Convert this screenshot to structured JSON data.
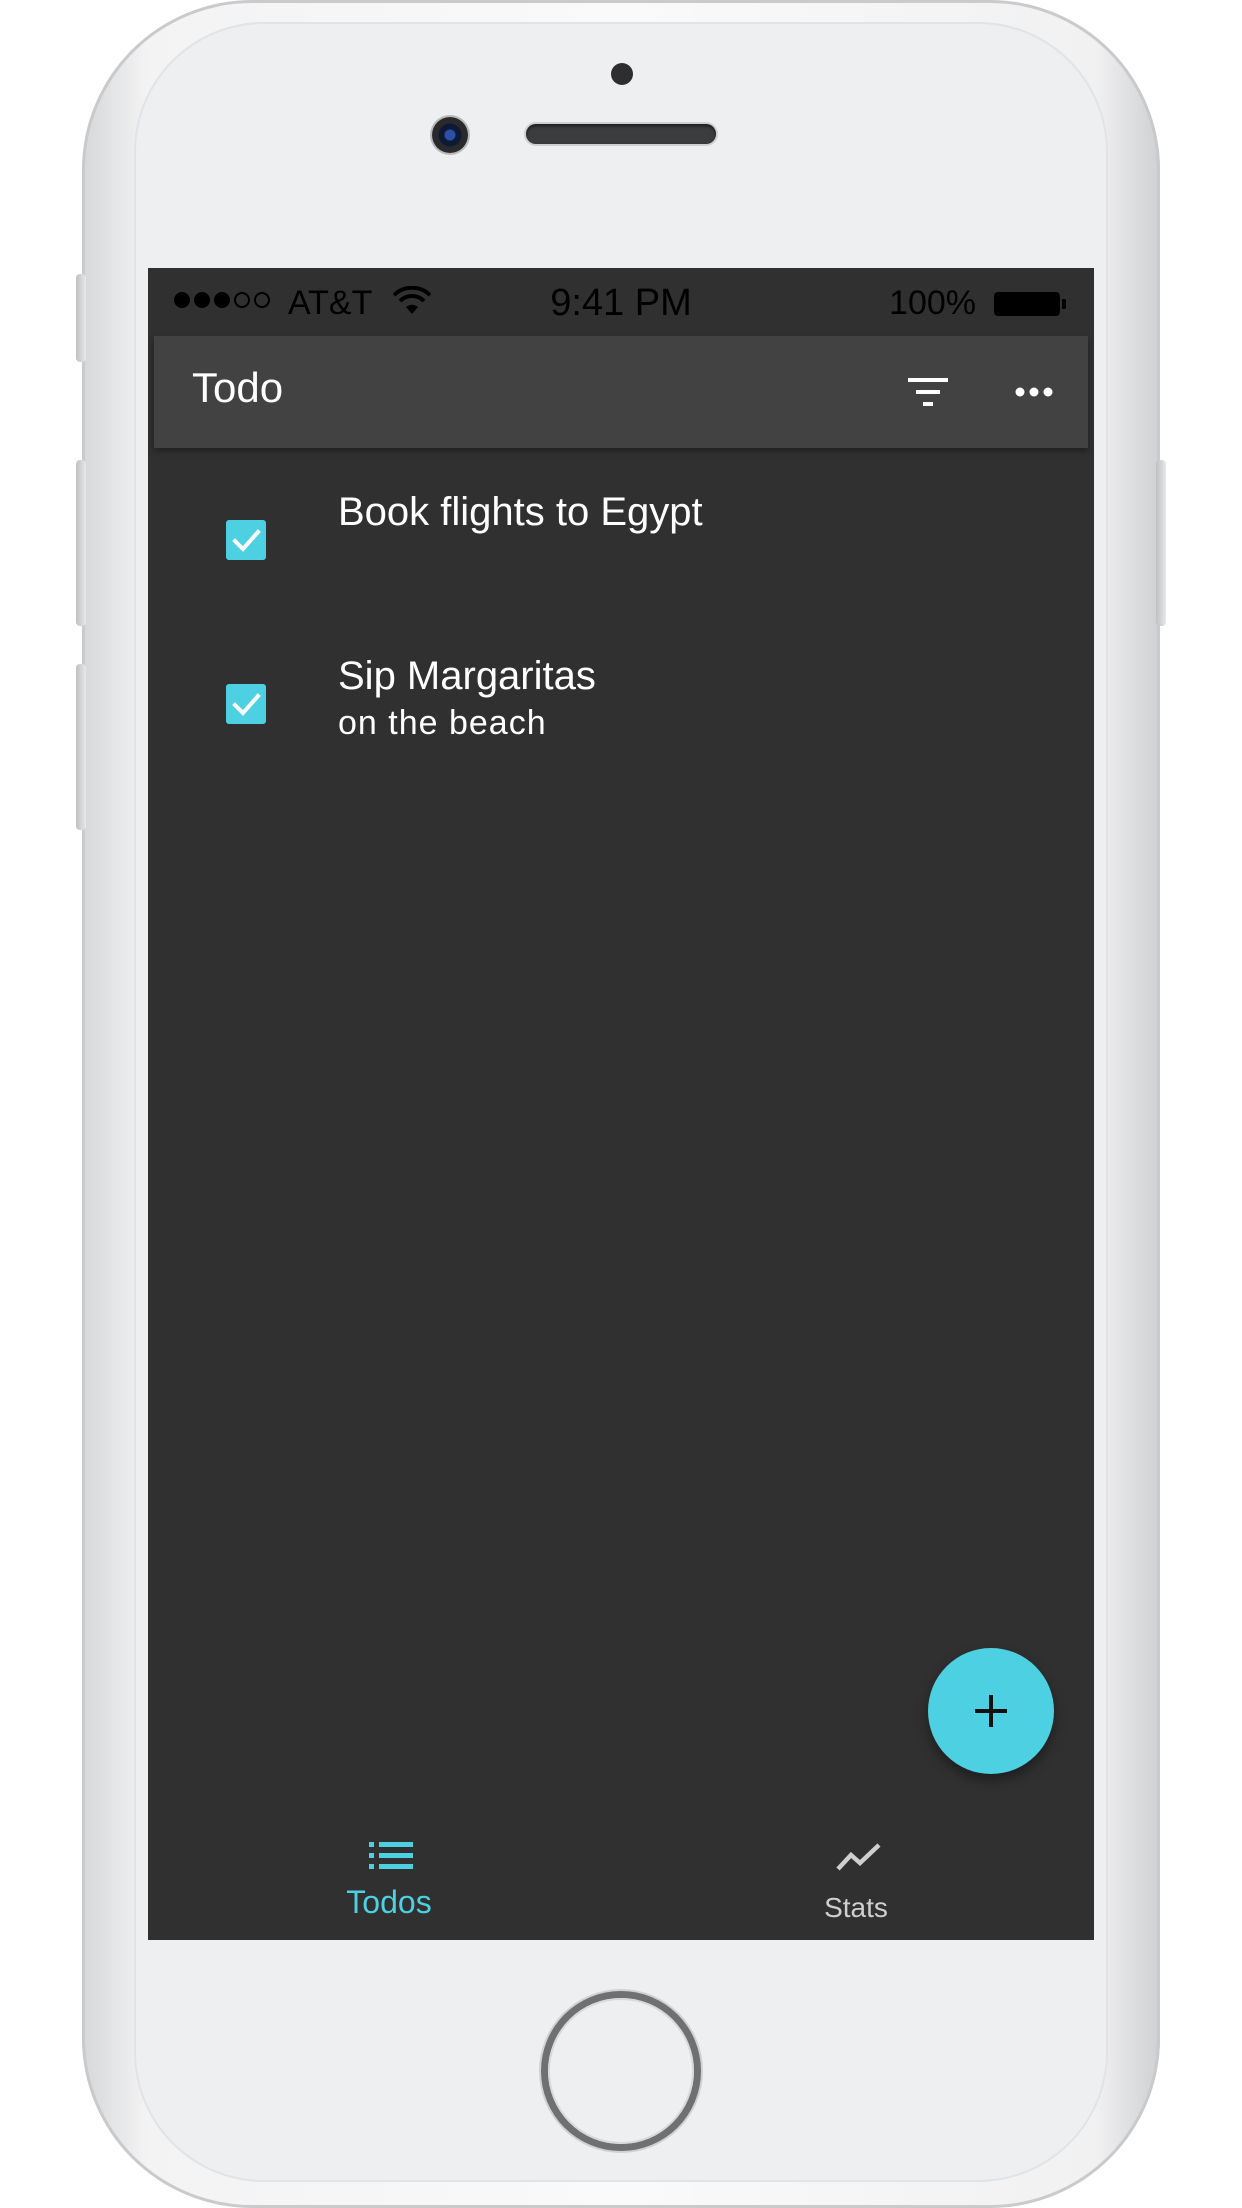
{
  "status_bar": {
    "carrier": "AT&T",
    "time": "9:41 PM",
    "battery": "100%"
  },
  "app_bar": {
    "title": "Todo",
    "actions": [
      "filter-icon",
      "more-icon"
    ]
  },
  "todos": [
    {
      "title": "Book flights to Egypt",
      "note": "",
      "completed": true
    },
    {
      "title": "Sip Margaritas",
      "note": "on the beach",
      "completed": true
    }
  ],
  "fab": {
    "icon": "plus-icon"
  },
  "bottom_nav": {
    "items": [
      {
        "label": "Todos",
        "icon": "list-icon",
        "active": true
      },
      {
        "label": "Stats",
        "icon": "trending-icon",
        "active": false
      }
    ]
  },
  "colors": {
    "accent": "#4dd0e1",
    "background": "#303030",
    "app_bar": "#424242"
  }
}
